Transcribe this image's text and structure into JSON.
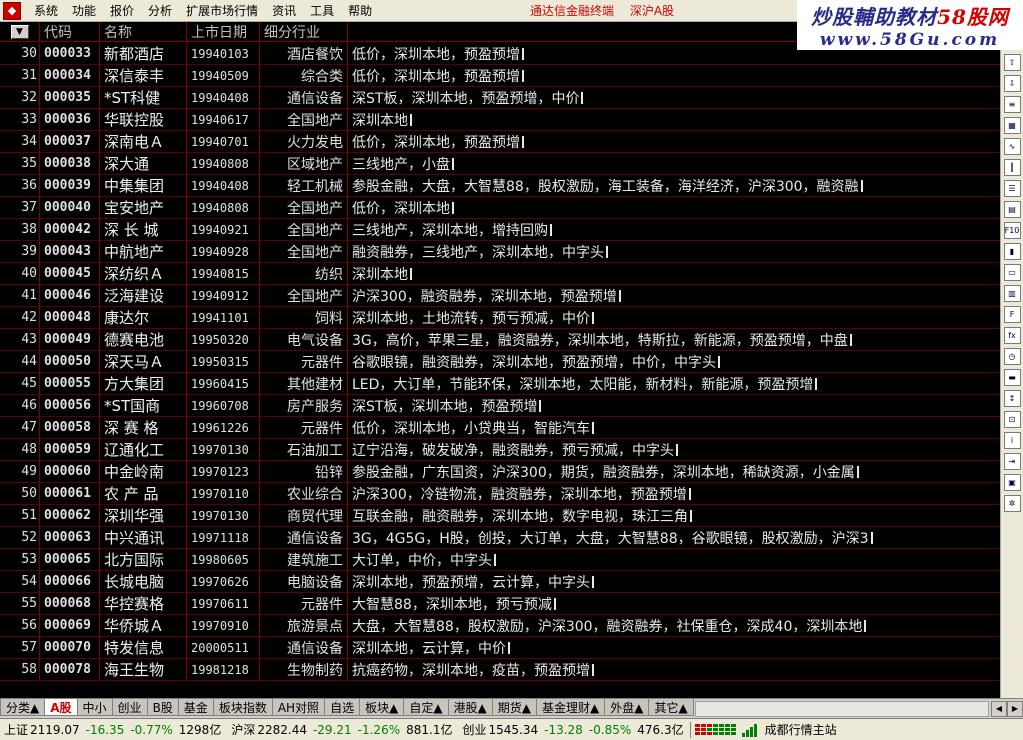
{
  "menu": {
    "logo_icon": "app-logo-icon",
    "items": [
      "系统",
      "功能",
      "报价",
      "分析",
      "扩展市场行情",
      "资讯",
      "工具",
      "帮助"
    ],
    "title_parts": [
      "通达信金融终端",
      "深沪A股"
    ]
  },
  "brand": {
    "line1_prefix": "炒股輔助教材",
    "line1_accent": "58股网",
    "line2": "www.58Gu.com"
  },
  "table": {
    "headers": {
      "sort_icon": "▼",
      "code": "代码",
      "name": "名称",
      "date": "上市日期",
      "industry": "细分行业"
    },
    "rows": [
      {
        "no": "30",
        "code": "000033",
        "name": "新都酒店",
        "date": "19940103",
        "industry": "酒店餐饮",
        "tags": "低价，深圳本地，预盈预增"
      },
      {
        "no": "31",
        "code": "000034",
        "name": "深信泰丰",
        "date": "19940509",
        "industry": "综合类",
        "tags": "低价，深圳本地，预盈预增"
      },
      {
        "no": "32",
        "code": "000035",
        "name": "*ST科健",
        "date": "19940408",
        "industry": "通信设备",
        "tags": "深ST板，深圳本地，预盈预增，中价"
      },
      {
        "no": "33",
        "code": "000036",
        "name": "华联控股",
        "date": "19940617",
        "industry": "全国地产",
        "tags": "深圳本地"
      },
      {
        "no": "34",
        "code": "000037",
        "name": "深南电Ａ",
        "date": "19940701",
        "industry": "火力发电",
        "tags": "低价，深圳本地，预盈预增"
      },
      {
        "no": "35",
        "code": "000038",
        "name": "深大通",
        "date": "19940808",
        "industry": "区域地产",
        "tags": "三线地产，小盘"
      },
      {
        "no": "36",
        "code": "000039",
        "name": "中集集团",
        "date": "19940408",
        "industry": "轻工机械",
        "tags": "参股金融，大盘，大智慧88，股权激励，海工装备，海洋经济，沪深300，融资融"
      },
      {
        "no": "37",
        "code": "000040",
        "name": "宝安地产",
        "date": "19940808",
        "industry": "全国地产",
        "tags": "低价，深圳本地"
      },
      {
        "no": "38",
        "code": "000042",
        "name": "深 长 城",
        "date": "19940921",
        "industry": "全国地产",
        "tags": "三线地产，深圳本地，增持回购"
      },
      {
        "no": "39",
        "code": "000043",
        "name": "中航地产",
        "date": "19940928",
        "industry": "全国地产",
        "tags": "融资融券，三线地产，深圳本地，中字头"
      },
      {
        "no": "40",
        "code": "000045",
        "name": "深纺织Ａ",
        "date": "19940815",
        "industry": "纺织",
        "tags": "深圳本地"
      },
      {
        "no": "41",
        "code": "000046",
        "name": "泛海建设",
        "date": "19940912",
        "industry": "全国地产",
        "tags": "沪深300，融资融券，深圳本地，预盈预增"
      },
      {
        "no": "42",
        "code": "000048",
        "name": "康达尔",
        "date": "19941101",
        "industry": "饲料",
        "tags": "深圳本地，土地流转，预亏预减，中价"
      },
      {
        "no": "43",
        "code": "000049",
        "name": "德赛电池",
        "date": "19950320",
        "industry": "电气设备",
        "tags": "3G，高价，苹果三星，融资融券，深圳本地，特斯拉，新能源，预盈预增，中盘"
      },
      {
        "no": "44",
        "code": "000050",
        "name": "深天马Ａ",
        "date": "19950315",
        "industry": "元器件",
        "tags": "谷歌眼镜，融资融券，深圳本地，预盈预增，中价，中字头"
      },
      {
        "no": "45",
        "code": "000055",
        "name": "方大集团",
        "date": "19960415",
        "industry": "其他建材",
        "tags": "LED，大订单，节能环保，深圳本地，太阳能，新材料，新能源，预盈预增"
      },
      {
        "no": "46",
        "code": "000056",
        "name": "*ST国商",
        "date": "19960708",
        "industry": "房产服务",
        "tags": "深ST板，深圳本地，预盈预增"
      },
      {
        "no": "47",
        "code": "000058",
        "name": "深 赛 格",
        "date": "19961226",
        "industry": "元器件",
        "tags": "低价，深圳本地，小贷典当，智能汽车"
      },
      {
        "no": "48",
        "code": "000059",
        "name": "辽通化工",
        "date": "19970130",
        "industry": "石油加工",
        "tags": "辽宁沿海，破发破净，融资融券，预亏预减，中字头"
      },
      {
        "no": "49",
        "code": "000060",
        "name": "中金岭南",
        "date": "19970123",
        "industry": "铅锌",
        "tags": "参股金融，广东国资，沪深300，期货，融资融券，深圳本地，稀缺资源，小金属"
      },
      {
        "no": "50",
        "code": "000061",
        "name": "农 产 品",
        "date": "19970110",
        "industry": "农业综合",
        "tags": "沪深300，冷链物流，融资融券，深圳本地，预盈预增"
      },
      {
        "no": "51",
        "code": "000062",
        "name": "深圳华强",
        "date": "19970130",
        "industry": "商贸代理",
        "tags": "互联金融，融资融券，深圳本地，数字电视，珠江三角"
      },
      {
        "no": "52",
        "code": "000063",
        "name": "中兴通讯",
        "date": "19971118",
        "industry": "通信设备",
        "tags": "3G，4G5G，H股，创投，大订单，大盘，大智慧88，谷歌眼镜，股权激励，沪深3"
      },
      {
        "no": "53",
        "code": "000065",
        "name": "北方国际",
        "date": "19980605",
        "industry": "建筑施工",
        "tags": "大订单，中价，中字头"
      },
      {
        "no": "54",
        "code": "000066",
        "name": "长城电脑",
        "date": "19970626",
        "industry": "电脑设备",
        "tags": "深圳本地，预盈预增，云计算，中字头"
      },
      {
        "no": "55",
        "code": "000068",
        "name": "华控赛格",
        "date": "19970611",
        "industry": "元器件",
        "tags": "大智慧88，深圳本地，预亏预减"
      },
      {
        "no": "56",
        "code": "000069",
        "name": "华侨城Ａ",
        "date": "19970910",
        "industry": "旅游景点",
        "tags": "大盘，大智慧88，股权激励，沪深300，融资融券，社保重仓，深成40，深圳本地"
      },
      {
        "no": "57",
        "code": "000070",
        "name": "特发信息",
        "date": "20000511",
        "industry": "通信设备",
        "tags": "深圳本地，云计算，中价"
      },
      {
        "no": "58",
        "code": "000078",
        "name": "海王生物",
        "date": "19981218",
        "industry": "生物制药",
        "tags": "抗癌药物，深圳本地，疫苗，预盈预增"
      }
    ]
  },
  "tabs": [
    "分类▲",
    "A股",
    "中小",
    "创业",
    "B股",
    "基金",
    "板块指数",
    "AH对照",
    "自选",
    "板块▲",
    "自定▲",
    "港股▲",
    "期货▲",
    "基金理财▲",
    "外盘▲",
    "其它▲"
  ],
  "active_tab": "A股",
  "status": {
    "sh": {
      "label": "上证",
      "value": "2119.07",
      "change": "-16.35",
      "pct": "-0.77%",
      "amount": "1298亿"
    },
    "hs": {
      "label": "沪深",
      "value": "2282.44",
      "change": "-29.21",
      "pct": "-1.26%",
      "amount": "881.1亿"
    },
    "cy": {
      "label": "创业",
      "value": "1545.34",
      "change": "-13.28",
      "pct": "-0.85%",
      "amount": "476.3亿"
    },
    "server": "成都行情主站"
  },
  "colors": {
    "up": "#d40000",
    "down": "#008000",
    "grid": "#800000",
    "bg": "#000000"
  }
}
